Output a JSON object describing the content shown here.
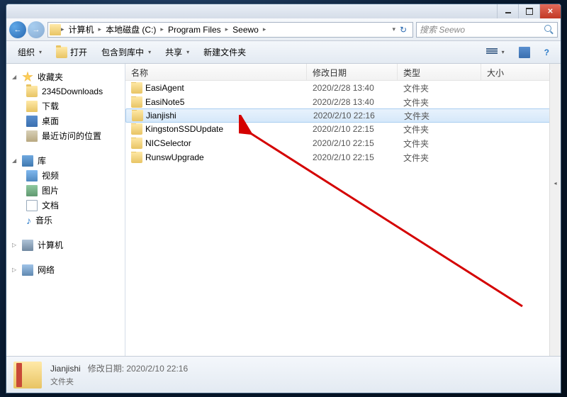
{
  "breadcrumb": [
    "计算机",
    "本地磁盘 (C:)",
    "Program Files",
    "Seewo"
  ],
  "search_placeholder": "搜索 Seewo",
  "toolbar": {
    "organize": "组织",
    "open": "打开",
    "include": "包含到库中",
    "share": "共享",
    "new_folder": "新建文件夹"
  },
  "sidebar": {
    "favorites": {
      "label": "收藏夹",
      "items": [
        "2345Downloads",
        "下载",
        "桌面",
        "最近访问的位置"
      ]
    },
    "library": {
      "label": "库",
      "items": [
        "视频",
        "图片",
        "文档",
        "音乐"
      ]
    },
    "computer": {
      "label": "计算机"
    },
    "network": {
      "label": "网络"
    }
  },
  "columns": {
    "name": "名称",
    "date": "修改日期",
    "type": "类型",
    "size": "大小"
  },
  "rows": [
    {
      "name": "EasiAgent",
      "date": "2020/2/28 13:40",
      "type": "文件夹",
      "selected": false
    },
    {
      "name": "EasiNote5",
      "date": "2020/2/28 13:40",
      "type": "文件夹",
      "selected": false
    },
    {
      "name": "Jianjishi",
      "date": "2020/2/10 22:16",
      "type": "文件夹",
      "selected": true
    },
    {
      "name": "KingstonSSDUpdate",
      "date": "2020/2/10 22:15",
      "type": "文件夹",
      "selected": false
    },
    {
      "name": "NICSelector",
      "date": "2020/2/10 22:15",
      "type": "文件夹",
      "selected": false
    },
    {
      "name": "RunswUpgrade",
      "date": "2020/2/10 22:15",
      "type": "文件夹",
      "selected": false
    }
  ],
  "details": {
    "name": "Jianjishi",
    "meta": "修改日期: 2020/2/10 22:16",
    "type": "文件夹"
  }
}
